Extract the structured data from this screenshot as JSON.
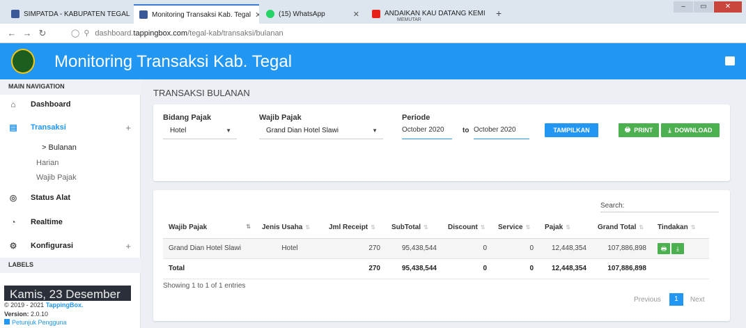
{
  "browser": {
    "tabs": [
      {
        "title": "SIMPATDA - KABUPATEN TEGAL",
        "close": "✕"
      },
      {
        "title": "Monitoring Transaksi Kab. Tegal",
        "close": "✕"
      },
      {
        "title": "(15) WhatsApp",
        "close": "✕"
      },
      {
        "title": "ANDAIKAN KAU DATANG KEMI",
        "subtitle": "MEMUTAR",
        "close": "✕"
      }
    ],
    "new_tab": "+",
    "url_prefix": "dashboard.",
    "url_domain": "tappingbox.com",
    "url_path": "/tegal-kab/transaksi/bulanan"
  },
  "header": {
    "title": "Monitoring Transaksi Kab. Tegal"
  },
  "sidebar": {
    "main_nav": "MAIN NAVIGATION",
    "items": [
      {
        "label": "Dashboard"
      },
      {
        "label": "Transaksi",
        "plus": "+"
      },
      {
        "label": "Status Alat"
      },
      {
        "label": "Realtime"
      },
      {
        "label": "Konfigurasi",
        "plus": "+"
      }
    ],
    "sub_items": [
      "> Bulanan",
      "Harian",
      "Wajib Pajak"
    ],
    "labels": "LABELS",
    "date": "Kamis, 23 Desember",
    "copyright_prefix": "© 2019 - 2021 ",
    "copyright_brand": "TappingBox.",
    "version_label": "Version:",
    "version": "2.0.10",
    "guide": "Petunjuk Pengguna"
  },
  "page": {
    "title": "TRANSAKSI BULANAN"
  },
  "filter": {
    "bidang_label": "Bidang Pajak",
    "bidang_value": "Hotel",
    "wajib_label": "Wajib Pajak",
    "wajib_value": "Grand Dian Hotel Slawi",
    "periode_label": "Periode",
    "from": "October 2020",
    "to_label": "to",
    "to": "October 2020",
    "show_button": "TAMPILKAN",
    "print_button": "PRINT",
    "download_button": "DOWNLOAD"
  },
  "table": {
    "search_label": "Search:",
    "columns": [
      "Wajib Pajak",
      "Jenis Usaha",
      "Jml Receipt",
      "SubTotal",
      "Discount",
      "Service",
      "Pajak",
      "Grand Total",
      "Tindakan"
    ],
    "rows": [
      [
        "Grand Dian Hotel Slawi",
        "Hotel",
        "270",
        "95,438,544",
        "0",
        "0",
        "12,448,354",
        "107,886,898"
      ]
    ],
    "total": [
      "Total",
      "",
      "270",
      "95,438,544",
      "0",
      "0",
      "12,448,354",
      "107,886,898"
    ],
    "info": "Showing 1 to 1 of 1 entries",
    "pagination": {
      "previous": "Previous",
      "page": "1",
      "next": "Next"
    }
  },
  "colors": {
    "primary": "#2196f3",
    "success": "#4caf50"
  }
}
